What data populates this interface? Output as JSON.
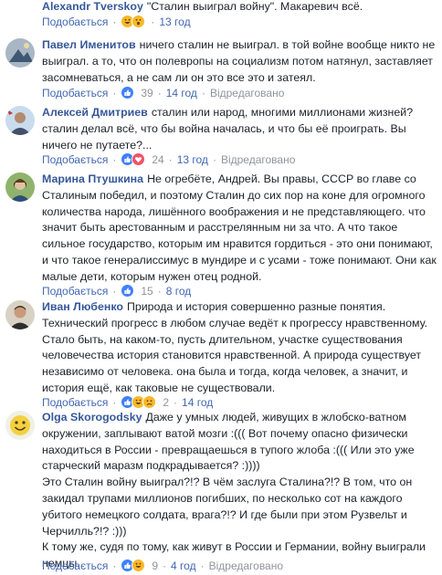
{
  "labels": {
    "like": "Подобається",
    "edited": "Відредаговано",
    "sep": "·"
  },
  "comments": [
    {
      "author": "Alexandr Tverskoy",
      "lines": [
        "\"Сталин выиграл войну\". Макаревич всё."
      ],
      "reactions": [],
      "reaction_icons": [
        "laugh-icon",
        "wow-icon"
      ],
      "count": "",
      "time": "13 год",
      "edited": false
    },
    {
      "author": "Павел Именитов",
      "lines": [
        "ничего сталин не выиграл. в той войне вообще никто не",
        "выиграл. а то, что он полевропы на социализм потом натянул, заставляет",
        "засомневаться, а не сам ли он это все это и затеял."
      ],
      "reaction_icons": [
        "like-icon"
      ],
      "count": "39",
      "time": "14 год",
      "edited": true
    },
    {
      "author": "Алексей Дмитриев",
      "lines": [
        "сталин или народ, многими миллионами жизней?",
        "сталин делал всё, что бы война началась, и что бы её проиграть. Вы",
        "ничего не путаете?..."
      ],
      "reaction_icons": [
        "like-icon",
        "love-icon"
      ],
      "count": "24",
      "time": "13 год",
      "edited": true
    },
    {
      "author": "Марина Птушкина",
      "lines": [
        "Не огребёте, Андрей. Вы правы, СССР во главе со",
        "Сталиным победил, и поэтому Сталин до сих пор на коне для огромного",
        "количества народа, лишённого воображения и не представляющего. что",
        "значит быть арестованным и расстрелянным ни за что. А что такое",
        "сильное государство, которым им нравится гордиться - это они понимают,",
        "и что такое генералиссимус в мундире и с усами - тоже понимают. Они как",
        "малые дети, которым нужен отец родной."
      ],
      "reaction_icons": [
        "like-icon"
      ],
      "count": "15",
      "time": "8 год",
      "edited": false
    },
    {
      "author": "Иван Любенко",
      "lines": [
        "Природа и история совершенно разные понятия.",
        "Технический прогресс в любом случае ведёт к прогрессу нравственному.",
        "Стало быть, на каком-то, пусть длительном, участке существования",
        "человечества история становится нравственной. А природа существует",
        "независимо от человека. она была и тогда, когда человек, а значит, и",
        "история ещё, как таковые не существовали."
      ],
      "reaction_icons": [
        "like-icon",
        "laugh-icon",
        "sad-icon"
      ],
      "count": "2",
      "time": "14 год",
      "edited": false
    },
    {
      "author": "Olga Skorogodsky",
      "lines": [
        "Даже у умных людей, живущих в жлобско-ватном",
        "окружении, заплывают ватой мозги :((( Вот почему опасно физически",
        "находиться в России - превращаешься в тупого жлоба :((( Или это уже",
        "старческий маразм подкрадывается? :))))",
        "Это Сталин войну выиграл?!? В чём заслуга Сталина?!? В том, что он",
        "закидал трупами миллионов погибших, по несколько сот на каждого",
        "убитого немецкого солдата, врага?!? И где были при этом Рузвельт и",
        "Черчилль?!? :)))",
        "К тому же, судя по тому, как живут в России и Германии, войну выиграли",
        "немцы."
      ],
      "reaction_icons": [
        "like-icon",
        "laugh-icon"
      ],
      "count": "9",
      "time": "4 год",
      "edited": true
    }
  ]
}
